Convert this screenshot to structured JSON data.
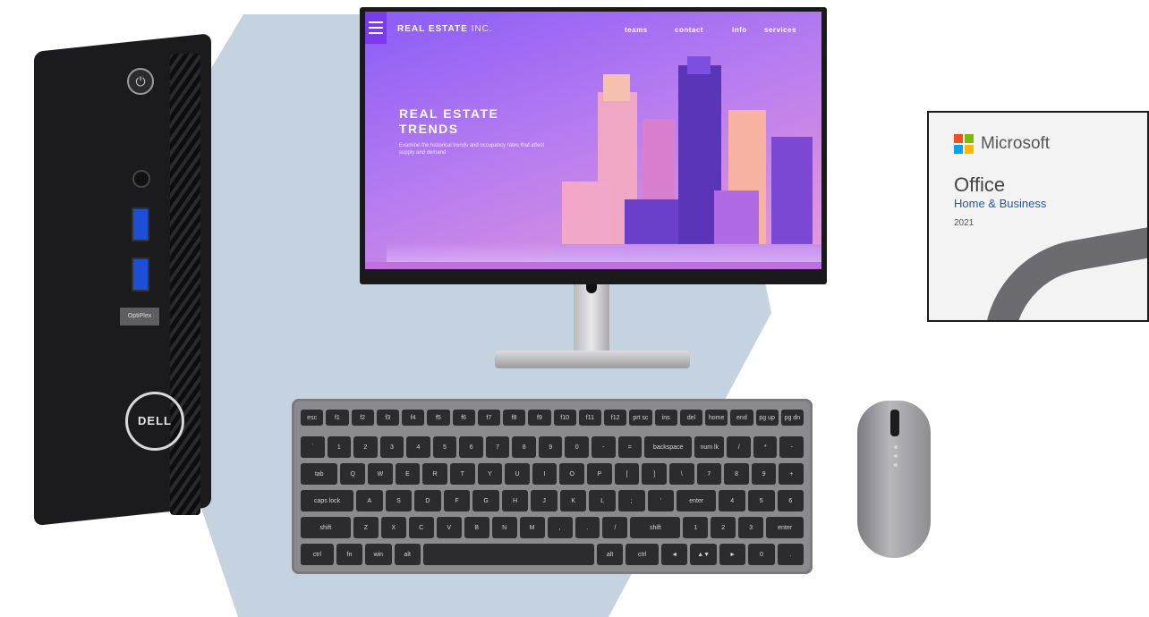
{
  "monitor_screen": {
    "brand_bold": "REAL ESTATE",
    "brand_light": " INC.",
    "nav": [
      "teams",
      "contact",
      "info",
      "services"
    ],
    "hero_title": "REAL ESTATE TRENDS",
    "hero_subtitle": "Examine the historical trends and occupancy rates that affect supply and demand"
  },
  "tower": {
    "model_label": "OptiPlex",
    "logo_text": "DELL"
  },
  "office_box": {
    "brand": "Microsoft",
    "product": "Office",
    "edition": "Home & Business",
    "year": "2021",
    "logo_colors": [
      "#f25022",
      "#7fba00",
      "#00a4ef",
      "#ffb900"
    ]
  },
  "keyboard": {
    "rows": [
      [
        "esc",
        "f1",
        "f2",
        "f3",
        "f4",
        "f5",
        "f6",
        "f7",
        "f8",
        "f9",
        "f10",
        "f11",
        "f12",
        "prt sc",
        "ins",
        "del",
        "home",
        "end",
        "pg up",
        "pg dn"
      ],
      [
        "`",
        "1",
        "2",
        "3",
        "4",
        "5",
        "6",
        "7",
        "8",
        "9",
        "0",
        "-",
        "=",
        "backspace",
        "num lk",
        "/",
        "*",
        "-"
      ],
      [
        "tab",
        "Q",
        "W",
        "E",
        "R",
        "T",
        "Y",
        "U",
        "I",
        "O",
        "P",
        "[",
        "]",
        "\\",
        "7",
        "8",
        "9",
        "+"
      ],
      [
        "caps lock",
        "A",
        "S",
        "D",
        "F",
        "G",
        "H",
        "J",
        "K",
        "L",
        ";",
        "'",
        "enter",
        "4",
        "5",
        "6"
      ],
      [
        "shift",
        "Z",
        "X",
        "C",
        "V",
        "B",
        "N",
        "M",
        ",",
        ".",
        "/",
        "shift",
        "1",
        "2",
        "3",
        "enter"
      ],
      [
        "ctrl",
        "fn",
        "win",
        "alt",
        "",
        "alt",
        "ctrl",
        "◄",
        "▲▼",
        "►",
        "0",
        "."
      ]
    ]
  },
  "colors": {
    "hexagon": "#c5d3e1",
    "screen_accent": "#7c3aed"
  }
}
